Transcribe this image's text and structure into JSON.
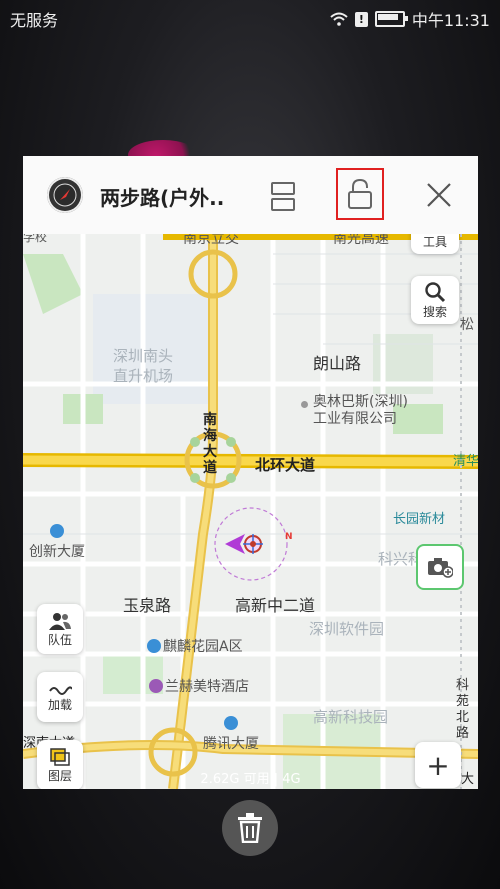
{
  "status": {
    "carrier": "无服务",
    "time": "中午11:31"
  },
  "card": {
    "app_title": "两步路(户外..",
    "icons": {
      "app": "compass-app-icon",
      "split": "split-screen-icon",
      "lock": "unlock-icon",
      "close": "close-icon"
    }
  },
  "map": {
    "top_labels": {
      "left": "南京立交",
      "right": "南光高速",
      "tl": "学校"
    },
    "tools": {
      "tools_label": "工具",
      "search_label": "搜索",
      "team_label": "队伍",
      "load_label": "加载",
      "layers_label": "图层"
    },
    "places": {
      "airport": "深圳南头\n直升机场",
      "langshan": "朗山路",
      "olympus": "奥林巴斯(深圳)\n工业有限公司",
      "nanhai": "南\n海\n大\n道",
      "beihuan": "北环大道",
      "qinghu": "清华",
      "changyuan": "长园新材",
      "chuangxin": "创新大厦",
      "kexing": "科兴科学园",
      "yuquan": "玉泉路",
      "gaoxin2": "高新中二道",
      "software": "深圳软件园",
      "qilin": "麒麟花园A区",
      "lanhe": "兰赫美特酒店",
      "gaoxin_tech": "高新科技园",
      "tencent": "腾讯大厦",
      "keyuan": "科\n苑\n北\n路",
      "song": "松",
      "shennan": "深南大道",
      "da": "大",
      "compass_n": "N"
    },
    "storage": "2.62G 可用 | 4G"
  },
  "dock": {
    "trash_icon": "trash-icon"
  }
}
